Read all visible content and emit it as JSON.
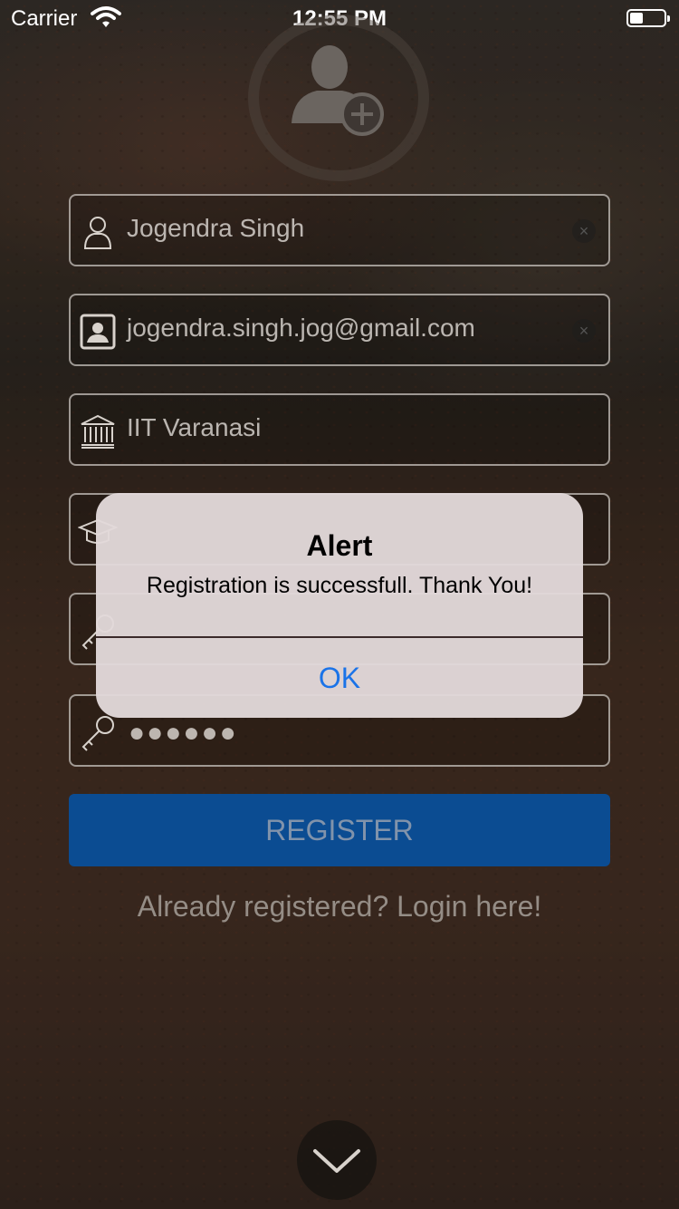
{
  "status_bar": {
    "carrier": "Carrier",
    "time": "12:55 PM"
  },
  "form": {
    "name_value": "Jogendra Singh",
    "email_value": "jogendra.singh.jog@gmail.com",
    "college_value": "IIT Varanasi",
    "password_mask": "●●●●●●",
    "register_label": "REGISTER",
    "login_link": "Already registered? Login here!"
  },
  "alert": {
    "title": "Alert",
    "message": "Registration is successfull. Thank You!",
    "ok_label": "OK"
  },
  "colors": {
    "register_button": "#0b4c92",
    "alert_ok": "#1a73e8",
    "alert_background": "#e2d8da"
  },
  "icons": {
    "add_user": "add-user-icon",
    "person": "person-icon",
    "contact_card": "contact-card-icon",
    "institution": "institution-icon",
    "graduation": "graduation-cap-icon",
    "key": "key-icon",
    "chevron": "chevron-down-icon",
    "wifi": "wifi-icon",
    "battery": "battery-icon"
  }
}
